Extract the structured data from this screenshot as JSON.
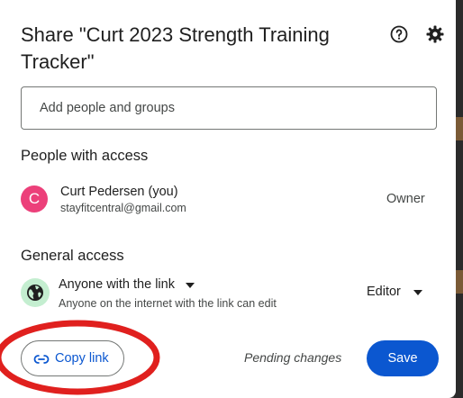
{
  "dialog": {
    "title": "Share \"Curt 2023 Strength Training Tracker\"",
    "help_icon": "help-circle-icon",
    "settings_icon": "gear-icon"
  },
  "add_people": {
    "placeholder": "Add people and groups"
  },
  "people_with_access": {
    "heading": "People with access",
    "users": [
      {
        "initial": "C",
        "name": "Curt Pedersen (you)",
        "email": "stayfitcentral@gmail.com",
        "role": "Owner",
        "avatar_color": "#ec407a"
      }
    ]
  },
  "general_access": {
    "heading": "General access",
    "scope": "Anyone with the link",
    "description": "Anyone on the internet with the link can edit",
    "role": "Editor",
    "icon": "globe-icon",
    "icon_bg": "#c4eed0"
  },
  "footer": {
    "copy_link_label": "Copy link",
    "pending_text": "Pending changes",
    "save_label": "Save"
  },
  "colors": {
    "accent": "#0b57d0",
    "annotation": "#e0201e"
  }
}
